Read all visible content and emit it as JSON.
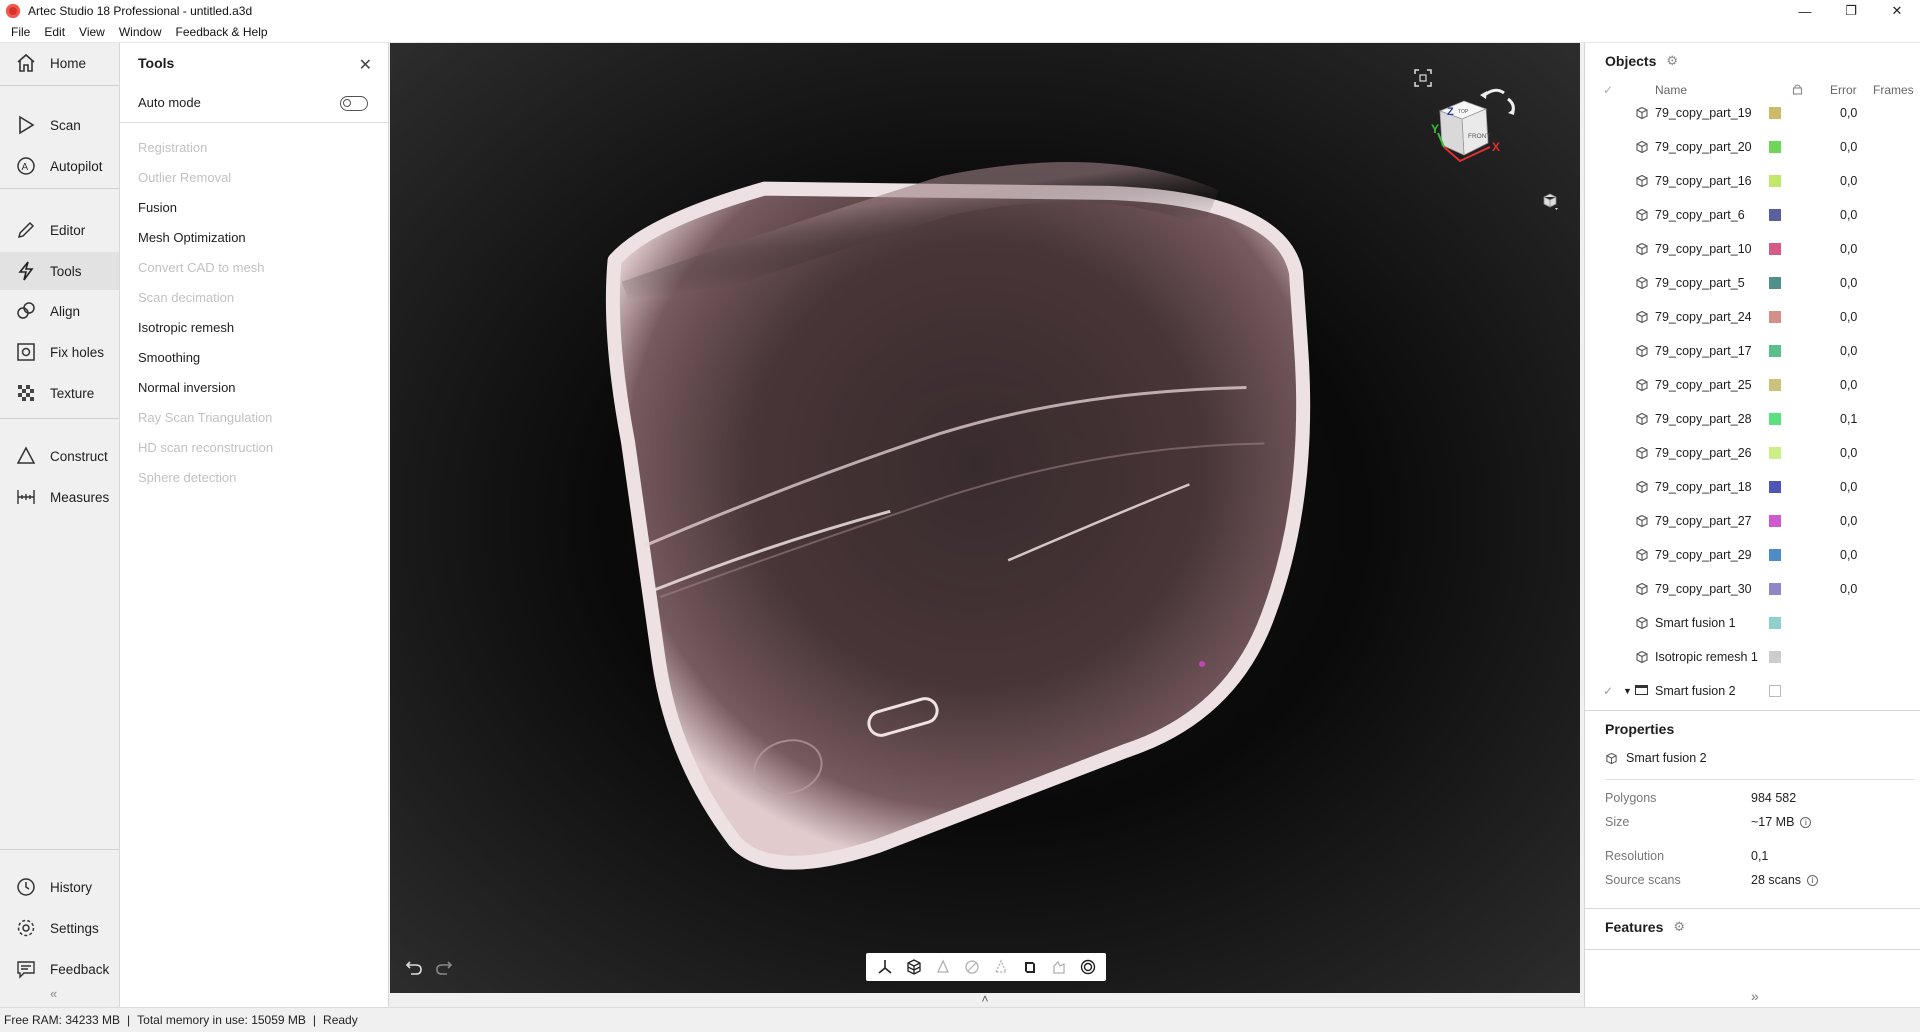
{
  "window": {
    "title": "Artec Studio 18 Professional - untitled.a3d",
    "controls": {
      "minimize": "—",
      "maximize": "❐",
      "close": "✕"
    }
  },
  "menu": [
    "File",
    "Edit",
    "View",
    "Window",
    "Feedback & Help"
  ],
  "leftnav": {
    "items": [
      {
        "label": "Home",
        "icon": "home-icon"
      },
      {
        "label": "Scan",
        "icon": "play-icon"
      },
      {
        "label": "Autopilot",
        "icon": "autopilot-icon"
      },
      {
        "label": "Editor",
        "icon": "pencil-icon"
      },
      {
        "label": "Tools",
        "icon": "lightning-icon",
        "active": true
      },
      {
        "label": "Align",
        "icon": "align-icon"
      },
      {
        "label": "Fix holes",
        "icon": "fix-holes-icon"
      },
      {
        "label": "Texture",
        "icon": "texture-icon"
      },
      {
        "label": "Construct",
        "icon": "triangle-icon"
      },
      {
        "label": "Measures",
        "icon": "ruler-icon"
      },
      {
        "label": "History",
        "icon": "history-icon"
      },
      {
        "label": "Settings",
        "icon": "gear-icon"
      },
      {
        "label": "Feedback",
        "icon": "message-icon"
      }
    ],
    "collapse": "«"
  },
  "tools_panel": {
    "title": "Tools",
    "close": "✕",
    "auto_mode_label": "Auto mode",
    "auto_mode_on": false,
    "items": [
      {
        "label": "Registration",
        "enabled": false
      },
      {
        "label": "Outlier Removal",
        "enabled": false
      },
      {
        "label": "Fusion",
        "enabled": true
      },
      {
        "label": "Mesh Optimization",
        "enabled": true
      },
      {
        "label": "Convert CAD to mesh",
        "enabled": false
      },
      {
        "label": "Scan decimation",
        "enabled": false
      },
      {
        "label": "Isotropic remesh",
        "enabled": true
      },
      {
        "label": "Smoothing",
        "enabled": true
      },
      {
        "label": "Normal inversion",
        "enabled": true
      },
      {
        "label": "Ray Scan Triangulation",
        "enabled": false
      },
      {
        "label": "HD scan reconstruction",
        "enabled": false
      },
      {
        "label": "Sphere detection",
        "enabled": false
      }
    ]
  },
  "viewport": {
    "cube_labels": {
      "top": "TOP",
      "front": "FRONT",
      "z": "Z",
      "y": "Y",
      "x": "X"
    },
    "bottom_expand": "˄",
    "toolbar_icons": [
      "axes-icon",
      "mesh-mode-icon",
      "shaded-icon",
      "wire-icon",
      "points-icon",
      "texture-mode-icon",
      "lighting-icon",
      "xray-icon"
    ]
  },
  "objects": {
    "title": "Objects",
    "columns": {
      "check": "✓",
      "name": "Name",
      "error": "Error",
      "frames": "Frames"
    },
    "rows": [
      {
        "name": "79_copy_part_19",
        "color": "#cdbb6a",
        "error": "0,0"
      },
      {
        "name": "79_copy_part_20",
        "color": "#6fd65a",
        "error": "0,0"
      },
      {
        "name": "79_copy_part_16",
        "color": "#c2e86a",
        "error": "0,0"
      },
      {
        "name": "79_copy_part_6",
        "color": "#5b5fa0",
        "error": "0,0"
      },
      {
        "name": "79_copy_part_10",
        "color": "#d65a86",
        "error": "0,0"
      },
      {
        "name": "79_copy_part_5",
        "color": "#4f8f8c",
        "error": "0,0"
      },
      {
        "name": "79_copy_part_24",
        "color": "#d49087",
        "error": "0,0"
      },
      {
        "name": "79_copy_part_17",
        "color": "#5bbf8a",
        "error": "0,0"
      },
      {
        "name": "79_copy_part_25",
        "color": "#cdc27c",
        "error": "0,0"
      },
      {
        "name": "79_copy_part_28",
        "color": "#5ae07e",
        "error": "0,1"
      },
      {
        "name": "79_copy_part_26",
        "color": "#cdef88",
        "error": "0,0"
      },
      {
        "name": "79_copy_part_18",
        "color": "#4d55b5",
        "error": "0,0"
      },
      {
        "name": "79_copy_part_27",
        "color": "#cf5ad0",
        "error": "0,0"
      },
      {
        "name": "79_copy_part_29",
        "color": "#4f8bc6",
        "error": "0,0"
      },
      {
        "name": "79_copy_part_30",
        "color": "#8f87c7",
        "error": "0,0"
      },
      {
        "name": "Smart fusion 1",
        "color": "#8fd0cc",
        "error": ""
      },
      {
        "name": "Isotropic remesh 1",
        "color": "#cccccc",
        "error": ""
      },
      {
        "name": "Smart fusion 2",
        "color": "",
        "error": "",
        "checked": true,
        "folder": true
      }
    ]
  },
  "properties": {
    "title": "Properties",
    "object": "Smart fusion 2",
    "rows": [
      {
        "key": "Polygons",
        "value": "984 582",
        "info": false
      },
      {
        "key": "Size",
        "value": "~17 MB",
        "info": true
      },
      {
        "key": "Resolution",
        "value": "0,1",
        "info": false
      },
      {
        "key": "Source scans",
        "value": "28 scans",
        "info": true
      }
    ]
  },
  "features": {
    "title": "Features",
    "expand": "»"
  },
  "status": {
    "free_ram": "Free RAM: 34233 MB",
    "total_memory": "Total memory in use: 15059 MB",
    "state": "Ready",
    "sep": "|"
  }
}
